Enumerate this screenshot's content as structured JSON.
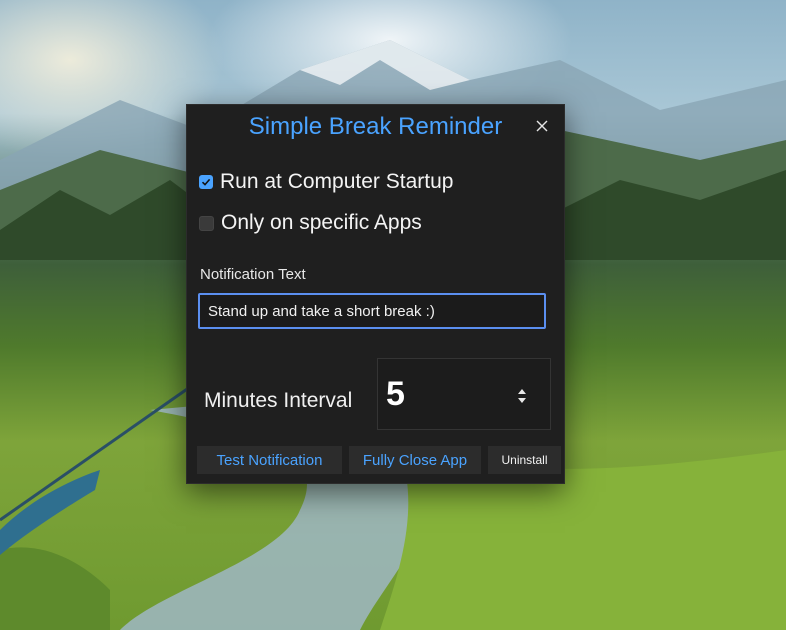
{
  "app": {
    "title": "Simple Break Reminder"
  },
  "options": {
    "run_at_startup": {
      "label": "Run at Computer Startup",
      "checked": true
    },
    "specific_apps": {
      "label": "Only on specific Apps",
      "checked": false
    }
  },
  "notification": {
    "label": "Notification Text",
    "value": "Stand up and take a short break :)"
  },
  "interval": {
    "label": "Minutes Interval",
    "value": "5"
  },
  "buttons": {
    "test": "Test Notification",
    "close_app": "Fully Close App",
    "uninstall": "Uninstall"
  },
  "colors": {
    "accent": "#4aa3ff",
    "window_bg": "#1f1f1f",
    "input_border": "#5b8ff0"
  },
  "icons": {
    "close": "close-icon",
    "check": "checkmark-icon",
    "stepper": "up-down-arrows-icon"
  }
}
